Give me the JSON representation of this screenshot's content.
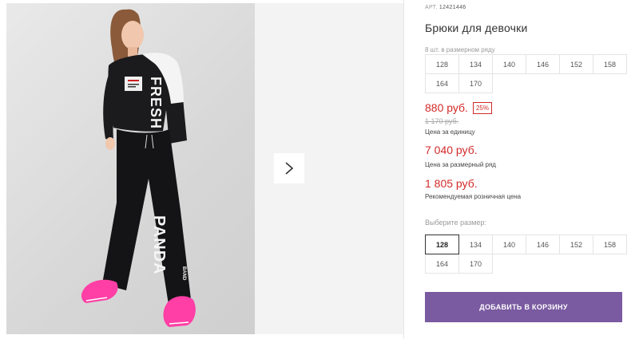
{
  "product": {
    "article_prefix": "АРТ.",
    "article_number": "12421446",
    "title": "Брюки для девочки",
    "set_label": "8 шт. в размерном ряду",
    "set_sizes": [
      "128",
      "134",
      "140",
      "146",
      "152",
      "158",
      "164",
      "170"
    ],
    "price": "880 руб.",
    "discount_badge": "25%",
    "old_price": "1 170 руб.",
    "unit_price_label": "Цена за единицу",
    "row_price": "7 040 руб.",
    "row_price_label": "Цена за размерный ряд",
    "rrp_price": "1 805 руб.",
    "rrp_label": "Рекомендуемая розничная цена",
    "choose_size_label": "Выберите размер:",
    "size_options": [
      "128",
      "134",
      "140",
      "146",
      "152",
      "158",
      "164",
      "170"
    ],
    "selected_size": "128",
    "add_to_cart_label": "ДОБАВИТЬ В КОРЗИНУ",
    "print_text_sleeve": "FRESH",
    "print_text_leg": "PANDA",
    "print_text_leg_small": "BAND"
  },
  "colors": {
    "price_red": "#d32a2a",
    "button_purple": "#7a5aa0",
    "sneaker_pink": "#ff3fa5"
  },
  "icons": {
    "next": "chevron-right-icon"
  }
}
